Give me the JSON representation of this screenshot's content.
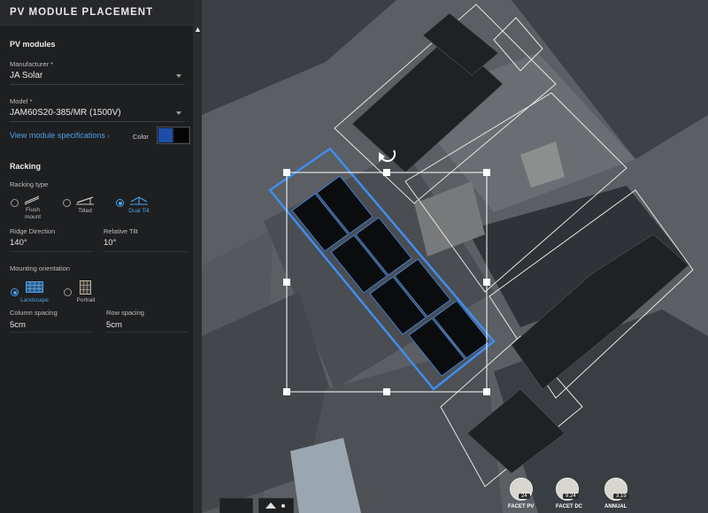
{
  "header": {
    "title": "PV MODULE PLACEMENT"
  },
  "pv_modules": {
    "section_title": "PV modules",
    "manufacturer": {
      "label": "Manufacturer *",
      "value": "JA Solar"
    },
    "model": {
      "label": "Model *",
      "value": "JAM60S20-385/MR (1500V)"
    },
    "specs_link": "View module specifications",
    "color": {
      "label": "Color",
      "options": [
        "#1e4fa8",
        "#050505"
      ]
    }
  },
  "racking": {
    "section_title": "Racking",
    "type_label": "Racking type",
    "types": [
      {
        "label": "Flush mount",
        "selected": false
      },
      {
        "label": "Tilted",
        "selected": false
      },
      {
        "label": "Dual Tilt",
        "selected": true
      }
    ],
    "ridge_direction": {
      "label": "Ridge Direction",
      "value": "140°"
    },
    "relative_tilt": {
      "label": "Relative Tilt",
      "value": "10°"
    }
  },
  "mounting": {
    "label": "Mounting orientation",
    "options": [
      {
        "label": "Landscape",
        "selected": true
      },
      {
        "label": "Portrait",
        "selected": false
      }
    ],
    "column_spacing": {
      "label": "Column spacing",
      "value": "5cm"
    },
    "row_spacing": {
      "label": "Row spacing",
      "value": "5cm"
    }
  },
  "map_badges": [
    {
      "label": "FACET PV",
      "value": "24"
    },
    {
      "label": "FACET DC",
      "value": "9.24"
    },
    {
      "label": "ANNUAL",
      "value": "3.15"
    }
  ],
  "colors": {
    "accent": "#4aa3e8",
    "panel_bg": "#1e1f21",
    "selection": "#3f8ef0"
  }
}
